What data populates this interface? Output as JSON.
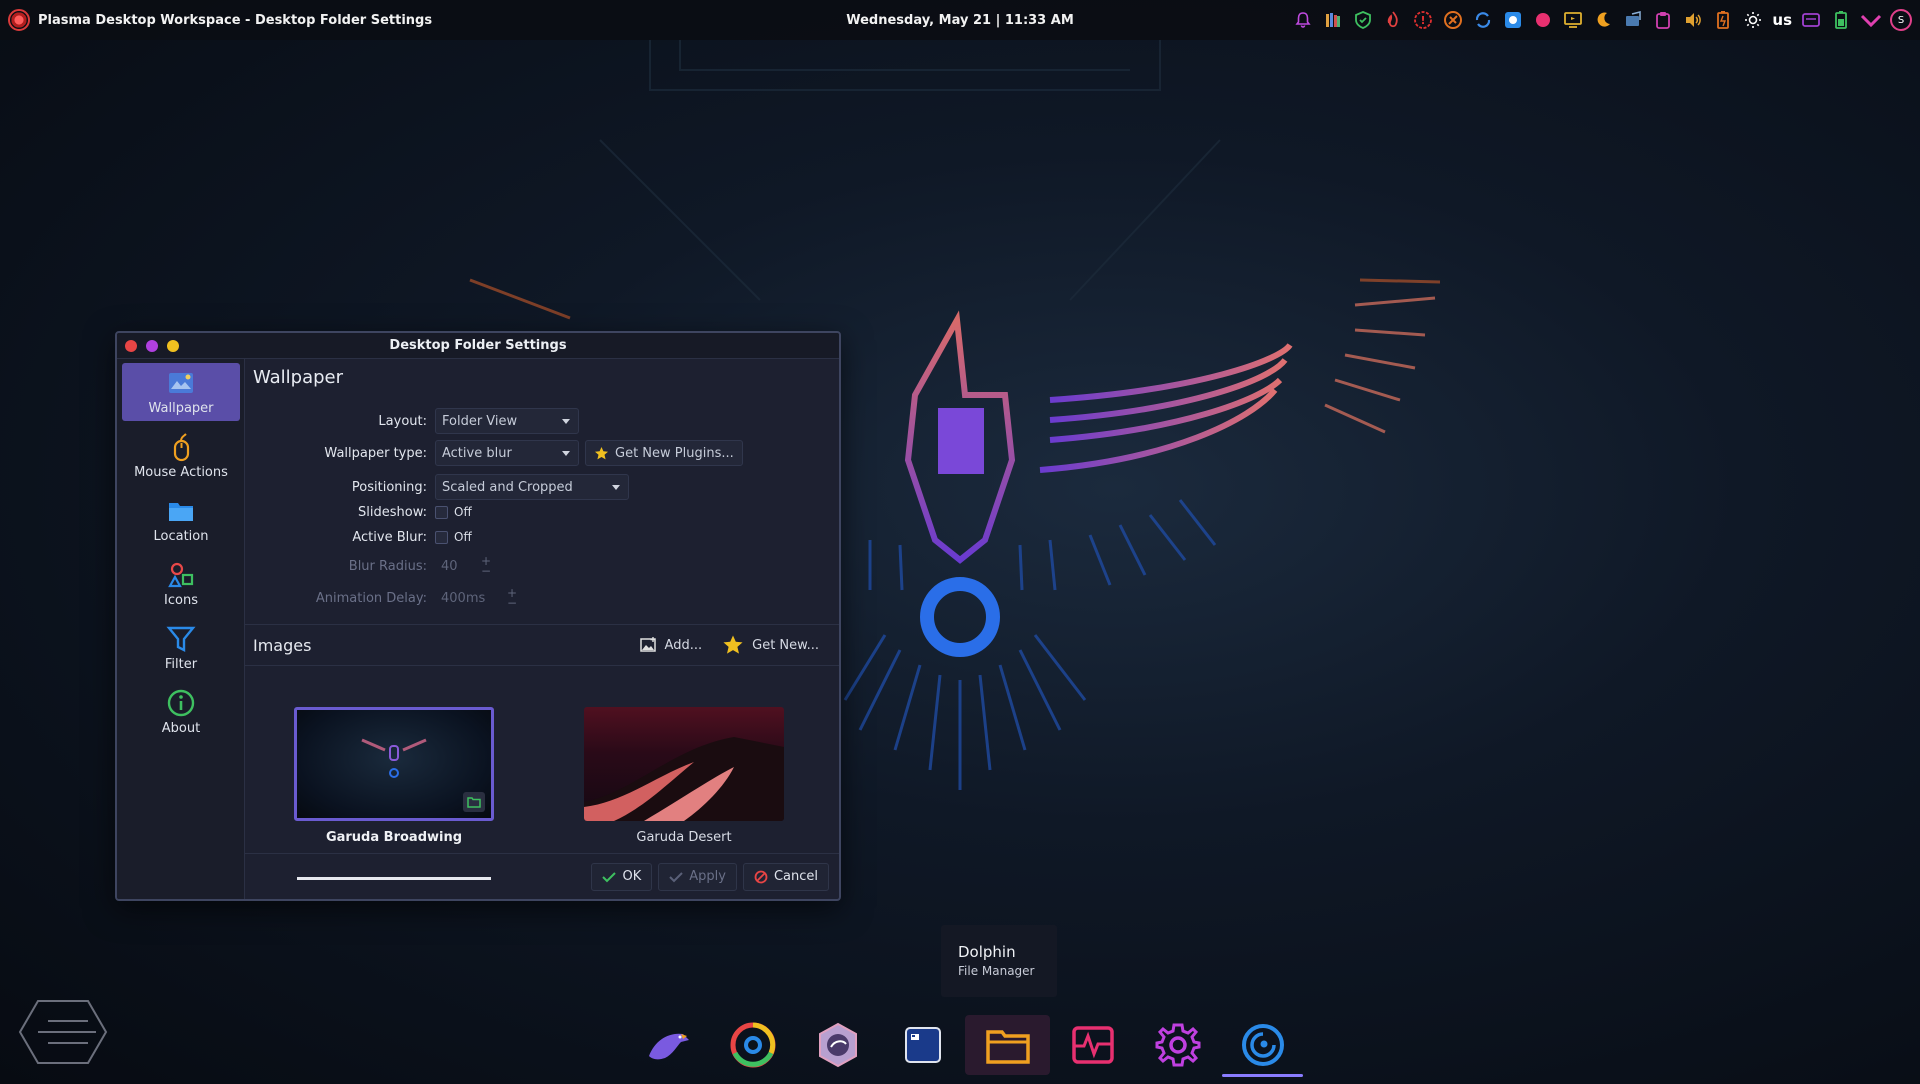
{
  "top_panel": {
    "window_title": "Plasma Desktop Workspace - Desktop Folder Settings",
    "clock": "Wednesday, May 21 | 11:33 AM",
    "keyboard_layout": "us",
    "avatar_letter": "S",
    "tray_icons": [
      "notifications-icon",
      "library-icon",
      "shield-icon",
      "flame-icon",
      "alert-icon",
      "update-icon",
      "sync-icon",
      "screenshot-icon",
      "record-icon",
      "display-icon",
      "night-light-icon",
      "network-icon",
      "clipboard-icon",
      "volume-icon",
      "battery-icon",
      "brightness-icon"
    ]
  },
  "dialog": {
    "title": "Desktop Folder Settings",
    "sidebar": [
      {
        "label": "Wallpaper",
        "icon": "wallpaper-icon",
        "active": true
      },
      {
        "label": "Mouse Actions",
        "icon": "mouse-icon",
        "active": false
      },
      {
        "label": "Location",
        "icon": "folder-icon",
        "active": false
      },
      {
        "label": "Icons",
        "icon": "icons-icon",
        "active": false
      },
      {
        "label": "Filter",
        "icon": "filter-icon",
        "active": false
      },
      {
        "label": "About",
        "icon": "info-icon",
        "active": false
      }
    ],
    "section_title": "Wallpaper",
    "form": {
      "layout_label": "Layout:",
      "layout_value": "Folder View",
      "wallpaper_type_label": "Wallpaper type:",
      "wallpaper_type_value": "Active blur",
      "get_new_plugins": "Get New Plugins...",
      "positioning_label": "Positioning:",
      "positioning_value": "Scaled and Cropped",
      "slideshow_label": "Slideshow:",
      "slideshow_value": "Off",
      "active_blur_label": "Active Blur:",
      "active_blur_value": "Off",
      "blur_radius_label": "Blur Radius:",
      "blur_radius_value": "40",
      "animation_delay_label": "Animation Delay:",
      "animation_delay_value": "400ms"
    },
    "images": {
      "title": "Images",
      "add_label": "Add...",
      "get_new_label": "Get New...",
      "items": [
        {
          "caption": "Garuda Broadwing",
          "selected": true
        },
        {
          "caption": "Garuda Desert",
          "selected": false
        }
      ]
    },
    "buttons": {
      "ok": "OK",
      "apply": "Apply",
      "cancel": "Cancel"
    }
  },
  "tooltip": {
    "title": "Dolphin",
    "subtitle": "File Manager"
  },
  "dock": [
    {
      "name": "garuda-icon"
    },
    {
      "name": "browser-icon"
    },
    {
      "name": "garuda-welcome-icon"
    },
    {
      "name": "terminal-icon"
    },
    {
      "name": "dolphin-icon",
      "hovered": true
    },
    {
      "name": "system-monitor-icon"
    },
    {
      "name": "settings-icon"
    },
    {
      "name": "garuda-assistant-icon",
      "active": true
    }
  ],
  "brand": "Broadwing",
  "colors": {
    "accent": "#5a4ea8",
    "selection_border": "#6a5bd0",
    "panel_bg": "#0b0d14",
    "dialog_bg": "#1d2030"
  }
}
